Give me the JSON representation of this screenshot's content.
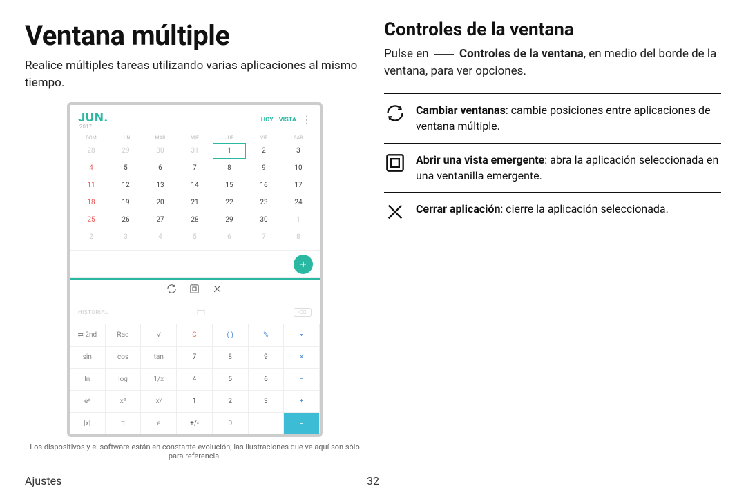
{
  "left": {
    "title": "Ventana múltiple",
    "lead": "Realice múltiples tareas utilizando varias aplicaciones al mismo tiempo."
  },
  "right": {
    "heading": "Controles de la ventana",
    "intro_pre": "Pulse en",
    "intro_bold": "Controles de la ventana",
    "intro_post": ", en medio del borde de la ventana, para ver opciones.",
    "items": [
      {
        "bold": "Cambiar ventanas",
        "rest": ": cambie posiciones entre aplicaciones de ventana múltiple."
      },
      {
        "bold": "Abrir una vista emergente",
        "rest": ": abra la aplicación seleccionada en una ventanilla emergente."
      },
      {
        "bold": "Cerrar aplicación",
        "rest": ": cierre la aplicación seleccionada."
      }
    ]
  },
  "calendar": {
    "month": "JUN.",
    "year": "2017",
    "links": {
      "hoy": "HOY",
      "vista": "VISTA"
    },
    "dow": [
      "DOM",
      "LUN",
      "MAR",
      "MIÉ",
      "JUE",
      "VIE",
      "SÁB"
    ],
    "weeks": [
      [
        "28",
        "29",
        "30",
        "31",
        "1",
        "2",
        "3"
      ],
      [
        "4",
        "5",
        "6",
        "7",
        "8",
        "9",
        "10"
      ],
      [
        "11",
        "12",
        "13",
        "14",
        "15",
        "16",
        "17"
      ],
      [
        "18",
        "19",
        "20",
        "21",
        "22",
        "23",
        "24"
      ],
      [
        "25",
        "26",
        "27",
        "28",
        "29",
        "30",
        "1"
      ],
      [
        "2",
        "3",
        "4",
        "5",
        "6",
        "7",
        "8"
      ]
    ],
    "fab": "+"
  },
  "calculator": {
    "history": "HISTORIAL",
    "rows": [
      [
        "⇄ 2nd",
        "Rad",
        "√",
        "C",
        "( )",
        "%",
        "÷"
      ],
      [
        "sin",
        "cos",
        "tan",
        "7",
        "8",
        "9",
        "×"
      ],
      [
        "ln",
        "log",
        "1/x",
        "4",
        "5",
        "6",
        "−"
      ],
      [
        "eˣ",
        "x²",
        "xʸ",
        "1",
        "2",
        "3",
        "+"
      ],
      [
        "|x|",
        "π",
        "e",
        "+/-",
        "0",
        ".",
        "="
      ]
    ]
  },
  "footnote": "Los dispositivos y el software están en constante evolución; las ilustraciones que ve aquí son sólo para referencia.",
  "footer": {
    "left": "Ajustes",
    "page": "32"
  }
}
